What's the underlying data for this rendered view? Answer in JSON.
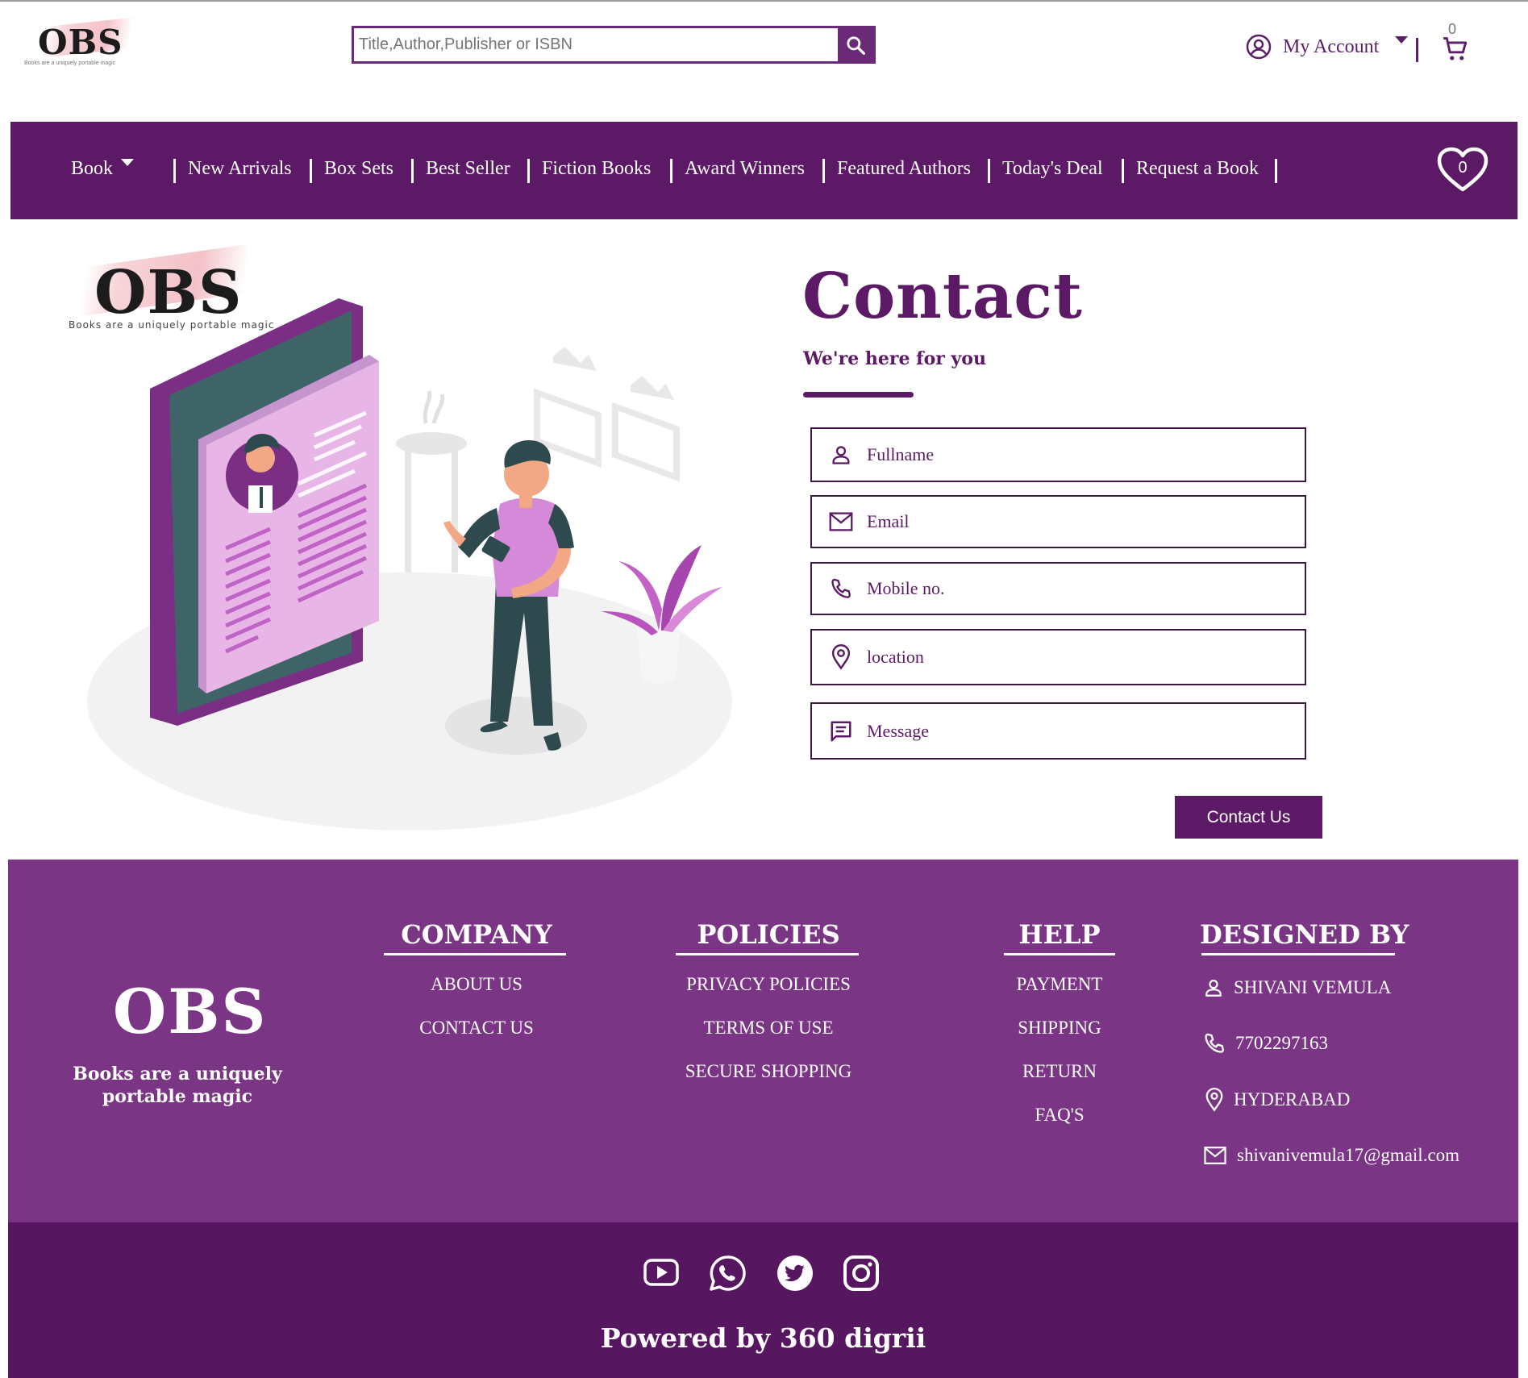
{
  "header": {
    "logo_text": "OBS",
    "logo_tagline": "Books are a uniquely portable magic",
    "search_placeholder": "Title,Author,Publisher or ISBN",
    "account_label": "My Account",
    "cart_count": "0"
  },
  "nav": {
    "items": [
      "Book",
      "New Arrivals",
      "Box Sets",
      "Best Seller",
      "Fiction Books",
      "Award Winners",
      "Featured Authors",
      "Today's Deal",
      "Request a Book"
    ],
    "wishlist_count": "0"
  },
  "hero": {
    "logo_text": "OBS",
    "logo_tagline": "Books are a uniquely portable magic"
  },
  "contact": {
    "title": "Contact",
    "subtitle": "We're here for you",
    "fields": {
      "fullname": "Fullname",
      "email": "Email",
      "mobile": "Mobile no.",
      "location": "location",
      "message": "Message"
    },
    "submit_label": "Contact Us"
  },
  "footer": {
    "brand": "OBS",
    "tagline_line1": "Books are a uniquely",
    "tagline_line2": "portable magic",
    "company": {
      "heading": "COMPANY",
      "links": [
        "ABOUT US",
        "CONTACT US"
      ]
    },
    "policies": {
      "heading": "POLICIES",
      "links": [
        "PRIVACY POLICIES",
        "TERMS OF USE",
        "SECURE SHOPPING"
      ]
    },
    "help": {
      "heading": "HELP",
      "links": [
        "PAYMENT",
        "SHIPPING",
        "RETURN",
        "FAQ'S"
      ]
    },
    "designed_by": {
      "heading": "DESIGNED BY",
      "name": "SHIVANI VEMULA",
      "phone": "7702297163",
      "location": "HYDERABAD",
      "email": "shivanivemula17@gmail.com"
    },
    "social_icons": [
      "youtube-icon",
      "whatsapp-icon",
      "twitter-icon",
      "instagram-icon"
    ],
    "powered_by": "Powered by 360 digrii"
  },
  "colors": {
    "primary": "#5c1a66",
    "footer_top": "#7a3584",
    "footer_bottom": "#561660",
    "illustration_accent": "#d88ad8"
  }
}
